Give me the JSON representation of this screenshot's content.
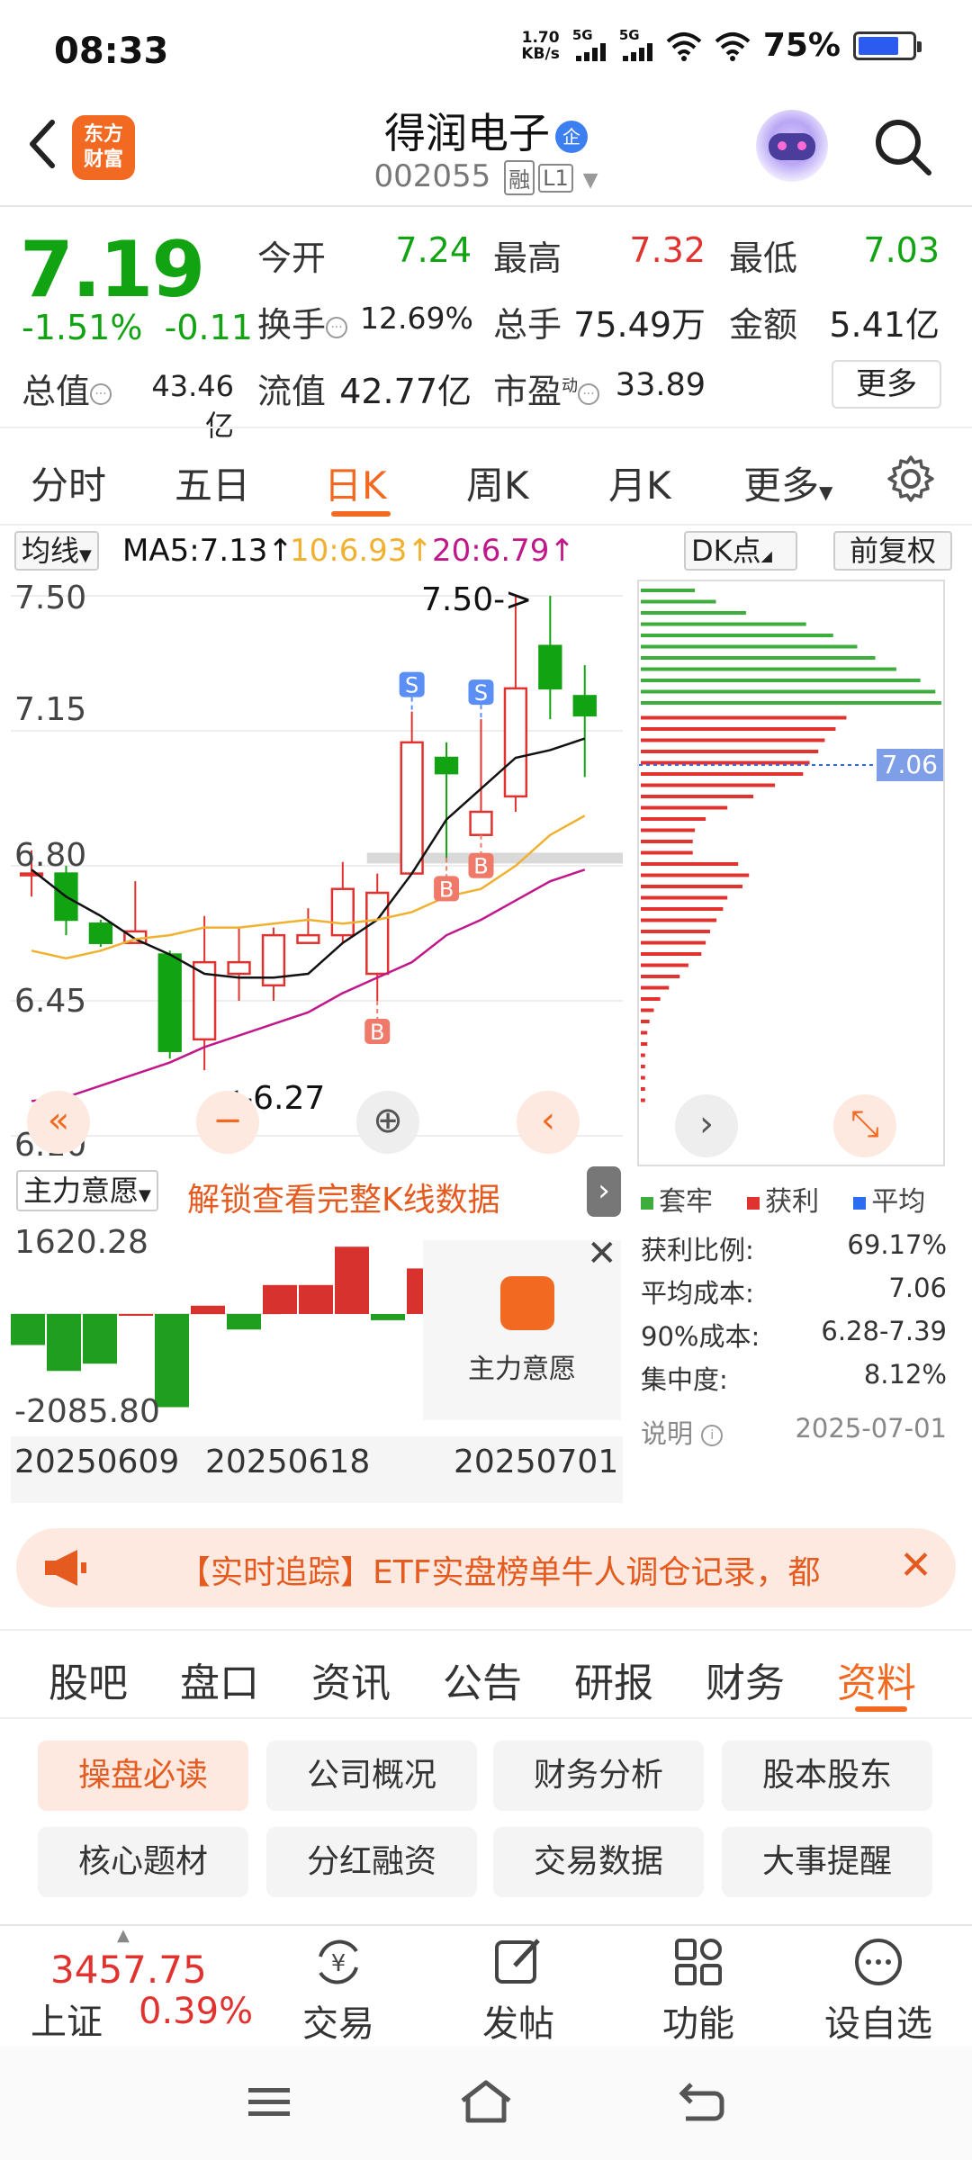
{
  "status_bar": {
    "time": "08:33",
    "net_speed": "1.70",
    "net_unit": "KB/s",
    "sig1": "5G",
    "sig2": "5G",
    "battery": "75%",
    "battery_level": 0.75
  },
  "header": {
    "logo_line1": "东方",
    "logo_line2": "财富",
    "title": "得润电子",
    "title_badge": "企",
    "code": "002055",
    "tag1": "融",
    "tag2": "L1"
  },
  "quote": {
    "price": "7.19",
    "change_pct": "-1.51%",
    "change_abs": "-0.11",
    "open_label": "今开",
    "open": "7.24",
    "high_label": "最高",
    "high": "7.32",
    "low_label": "最低",
    "low": "7.03",
    "turnover_label": "换手",
    "turnover": "12.69%",
    "volume_label": "总手",
    "volume": "75.49万",
    "amount_label": "金额",
    "amount": "5.41亿",
    "mktcap_label": "总值",
    "mktcap": "43.46亿",
    "float_label": "流值",
    "float_cap": "42.77亿",
    "pe_label": "市盈",
    "pe_sup": "动",
    "pe": "33.89",
    "more_label": "更多"
  },
  "period_tabs": [
    "分时",
    "五日",
    "日K",
    "周K",
    "月K",
    "更多"
  ],
  "ma": {
    "selector": "均线",
    "ma5": "MA5:7.13↑",
    "ma10": "10:6.93↑",
    "ma20": "20:6.79↑",
    "dk": "DK点",
    "adjust": "前复权",
    "colors": {
      "ma5": "#111111",
      "ma10": "#f0b030",
      "ma20": "#c0188a"
    }
  },
  "chart_data": {
    "type": "candlestick",
    "ylim": [
      6.1,
      7.5
    ],
    "y_ticks": [
      "7.50",
      "7.15",
      "6.80",
      "6.45",
      "6.10"
    ],
    "annotations": {
      "high_label": "7.50->",
      "low_label": "<-6.27",
      "avg_cost": "7.06"
    },
    "candles": [
      {
        "o": 6.78,
        "c": 6.78,
        "h": 6.84,
        "l": 6.72
      },
      {
        "o": 6.78,
        "c": 6.66,
        "h": 6.8,
        "l": 6.62
      },
      {
        "o": 6.65,
        "c": 6.6,
        "h": 6.66,
        "l": 6.59
      },
      {
        "o": 6.6,
        "c": 6.63,
        "h": 6.76,
        "l": 6.6
      },
      {
        "o": 6.57,
        "c": 6.32,
        "h": 6.58,
        "l": 6.3
      },
      {
        "o": 6.35,
        "c": 6.55,
        "h": 6.67,
        "l": 6.27
      },
      {
        "o": 6.52,
        "c": 6.55,
        "h": 6.64,
        "l": 6.45
      },
      {
        "o": 6.49,
        "c": 6.62,
        "h": 6.64,
        "l": 6.45
      },
      {
        "o": 6.6,
        "c": 6.62,
        "h": 6.69,
        "l": 6.6
      },
      {
        "o": 6.62,
        "c": 6.74,
        "h": 6.81,
        "l": 6.6
      },
      {
        "o": 6.52,
        "c": 6.73,
        "h": 6.78,
        "l": 6.45
      },
      {
        "o": 6.78,
        "c": 7.12,
        "h": 7.2,
        "l": 6.78
      },
      {
        "o": 7.08,
        "c": 7.04,
        "h": 7.12,
        "l": 6.82
      },
      {
        "o": 6.88,
        "c": 6.94,
        "h": 7.18,
        "l": 6.88
      },
      {
        "o": 6.98,
        "c": 7.26,
        "h": 7.5,
        "l": 6.94
      },
      {
        "o": 7.37,
        "c": 7.26,
        "h": 7.5,
        "l": 7.18
      },
      {
        "o": 7.24,
        "c": 7.19,
        "h": 7.32,
        "l": 7.03
      }
    ],
    "ma5": [
      6.79,
      6.72,
      6.67,
      6.61,
      6.57,
      6.52,
      6.51,
      6.51,
      6.52,
      6.6,
      6.66,
      6.78,
      6.92,
      7.0,
      7.08,
      7.1,
      7.13
    ],
    "ma10": [
      6.58,
      6.56,
      6.58,
      6.61,
      6.62,
      6.64,
      6.64,
      6.65,
      6.66,
      6.65,
      6.66,
      6.68,
      6.72,
      6.74,
      6.8,
      6.88,
      6.93
    ],
    "ma20": [
      6.19,
      6.2,
      6.23,
      6.26,
      6.29,
      6.33,
      6.36,
      6.39,
      6.42,
      6.47,
      6.51,
      6.55,
      6.62,
      6.66,
      6.71,
      6.76,
      6.79
    ],
    "signals": [
      {
        "idx": 11,
        "type": "S"
      },
      {
        "idx": 13,
        "type": "S"
      },
      {
        "idx": 12,
        "type": "B"
      },
      {
        "idx": 13,
        "type": "B"
      },
      {
        "idx": 10,
        "type": "B"
      }
    ]
  },
  "chip": {
    "legend": [
      "套牢",
      "获利",
      "平均"
    ],
    "legend_colors": [
      "#3dae3d",
      "#e0332f",
      "#2c6cf0"
    ],
    "stats": [
      {
        "label": "获利比例:",
        "value": "69.17%"
      },
      {
        "label": "平均成本:",
        "value": "7.06"
      },
      {
        "label": "90%成本:",
        "value": "6.28-7.39"
      },
      {
        "label": "集中度:",
        "value": "8.12%"
      }
    ],
    "note_label": "说明",
    "date": "2025-07-01",
    "bars_green": [
      0.18,
      0.25,
      0.35,
      0.55,
      0.64,
      0.72,
      0.78,
      0.85,
      0.93,
      0.98,
      1.0
    ],
    "bars_red": [
      0.95,
      0.9,
      0.85,
      0.82,
      0.78,
      0.75,
      0.62,
      0.52,
      0.4,
      0.3,
      0.25,
      0.24,
      0.24,
      0.45,
      0.5,
      0.47,
      0.4,
      0.38,
      0.35,
      0.32,
      0.3,
      0.28,
      0.22,
      0.18,
      0.13,
      0.09,
      0.06,
      0.04,
      0.03,
      0.03,
      0.02,
      0.02,
      0.02,
      0.02,
      0.02
    ]
  },
  "indicator": {
    "selector": "主力意愿",
    "lock_text": "解锁查看完整K线数据",
    "ymax": "1620.28",
    "ymin": "-2085.80",
    "panel_label": "主力意愿",
    "dates": [
      "20250609",
      "20250618",
      "20250701"
    ],
    "values": [
      -30,
      -55,
      -48,
      0,
      -90,
      8,
      -15,
      28,
      28,
      65,
      -6,
      44
    ]
  },
  "news": {
    "text": "【实时追踪】ETF实盘榜单牛人调仓记录，都"
  },
  "info_tabs": [
    "股吧",
    "盘口",
    "资讯",
    "公告",
    "研报",
    "财务",
    "资料"
  ],
  "pills": [
    "操盘必读",
    "公司概况",
    "财务分析",
    "股本股东",
    "核心题材",
    "分红融资",
    "交易数据",
    "大事提醒"
  ],
  "bottom": {
    "index_value": "3457.75",
    "index_name": "上证",
    "index_pct": "0.39%",
    "items": [
      "交易",
      "发帖",
      "功能",
      "设自选"
    ]
  }
}
